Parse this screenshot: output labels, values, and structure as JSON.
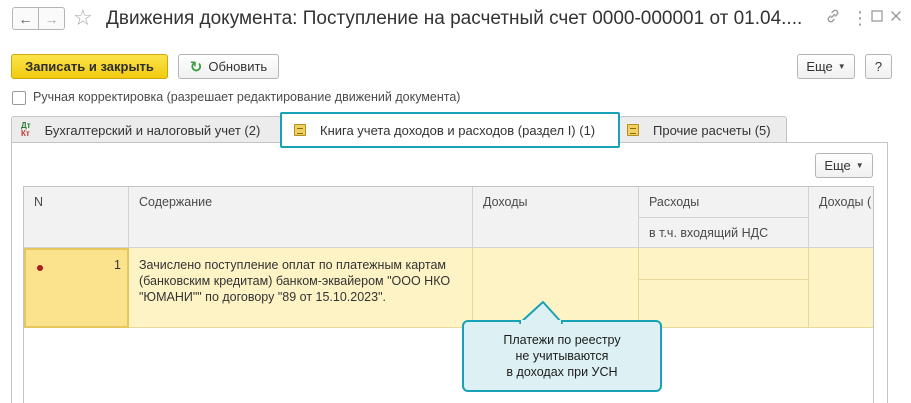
{
  "header": {
    "back_icon": "arrow-left-icon",
    "forward_icon": "arrow-right-icon",
    "favorite_icon": "star-icon",
    "title": "Движения документа: Поступление на расчетный счет 0000-000001 от 01.04....",
    "link_icon": "link-icon",
    "menu_icon": "more-vertical-icon",
    "maximize_icon": "maximize-icon",
    "close_icon": "close-icon"
  },
  "toolbar": {
    "save_close_label": "Записать и закрыть",
    "refresh_label": "Обновить",
    "more_label": "Еще",
    "help_label": "?"
  },
  "manual_adjust": {
    "label": "Ручная корректировка (разрешает редактирование движений документа)",
    "checked": false
  },
  "tabs": [
    {
      "label": "Бухгалтерский и налоговый учет (2)",
      "icon_text_top": "Дт",
      "icon_text_bottom": "Кт"
    },
    {
      "label": "Книга учета доходов и расходов (раздел I) (1)",
      "active": true
    },
    {
      "label": "Прочие расчеты (5)"
    }
  ],
  "grid": {
    "more_label": "Еще",
    "columns": {
      "n": "N",
      "content": "Содержание",
      "income": "Доходы",
      "expenses": "Расходы",
      "vat": "в т.ч. входящий НДС",
      "income2": "Доходы ("
    },
    "rows": [
      {
        "n": "1",
        "content": "Зачислено поступление оплат по платежным картам (банковским кредитам) банком-эквайером \"ООО НКО \"ЮМАНИ\"\" по договору \"89 от 15.10.2023\".",
        "income": "",
        "expenses": "",
        "vat": ""
      }
    ]
  },
  "callout": {
    "line1": "Платежи по реестру",
    "line2": "не учитываются",
    "line3": "в доходах при УСН"
  },
  "colors": {
    "accent_highlight": "#17a2b8",
    "primary_button": "#f2cc10",
    "selected_row": "#fdf3c5"
  }
}
